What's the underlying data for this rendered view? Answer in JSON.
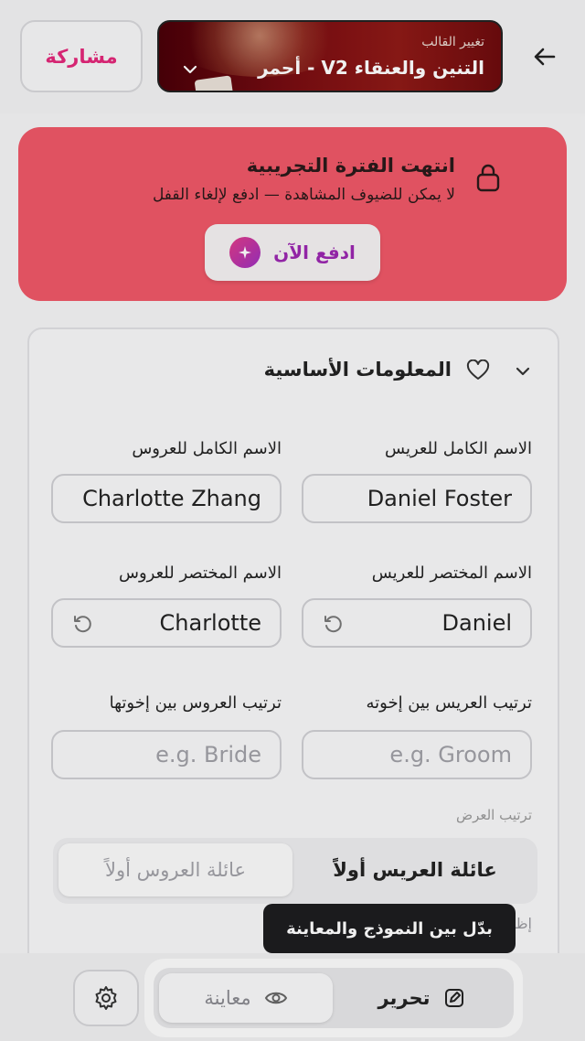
{
  "header": {
    "template_small_label": "تغيير القالب",
    "template_name": "التنين والعنقاء V2 - أحمر",
    "share_label": "مشاركة"
  },
  "banner": {
    "title": "انتهت الفترة التجريبية",
    "subtitle": "لا يمكن للضيوف المشاهدة — ادفع لإلغاء القفل",
    "pay_label": "ادفع الآن"
  },
  "section": {
    "title": "المعلومات الأساسية",
    "fields": {
      "groom_full_label": "الاسم الكامل للعريس",
      "groom_full_value": "Daniel Foster",
      "bride_full_label": "الاسم الكامل للعروس",
      "bride_full_value": "Charlotte Zhang",
      "groom_short_label": "الاسم المختصر للعريس",
      "groom_short_value": "Daniel",
      "bride_short_label": "الاسم المختصر للعروس",
      "bride_short_value": "Charlotte",
      "groom_order_label": "ترتيب العريس بين إخوته",
      "groom_order_placeholder": "e.g. Groom",
      "bride_order_label": "ترتيب العروس بين إخوتها",
      "bride_order_placeholder": "e.g. Bride"
    },
    "display_order_label": "ترتيب العرض",
    "display_order_options": {
      "groom_first": "عائلة العريس أولاً",
      "bride_first": "عائلة العروس أولاً"
    },
    "hint_text": "إظ                                  قة الدعوة"
  },
  "tooltip": {
    "text": "بدّل بين النموذج والمعاينة"
  },
  "bottom_bar": {
    "edit_label": "تحرير",
    "preview_label": "معاينة"
  }
}
